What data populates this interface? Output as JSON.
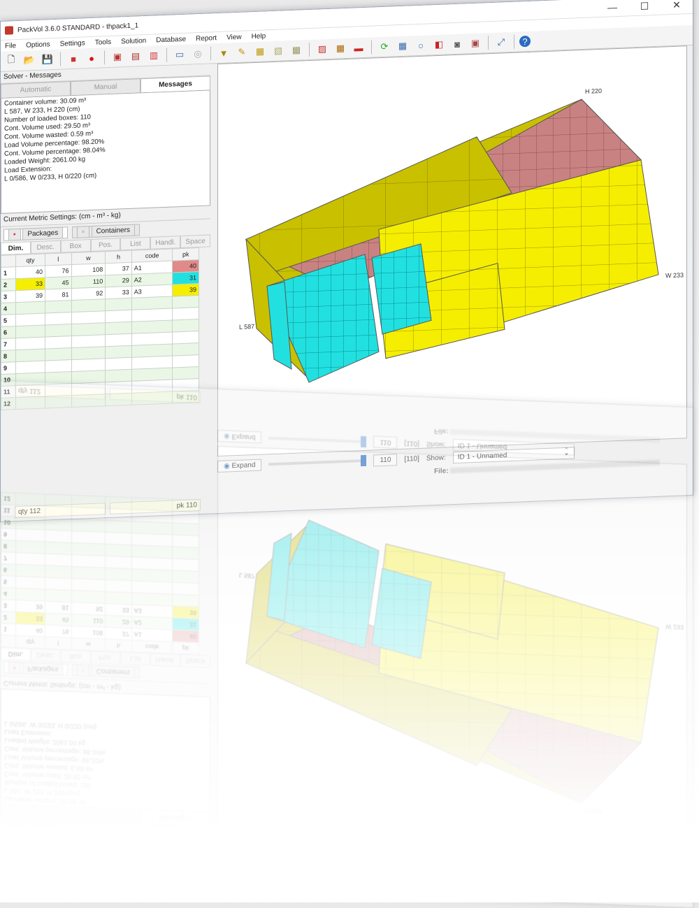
{
  "window": {
    "title": "PackVol 3.6.0 STANDARD - thpack1_1",
    "minimize": "—",
    "maximize": "☐",
    "close": "✕"
  },
  "menu": [
    "File",
    "Options",
    "Settings",
    "Tools",
    "Solution",
    "Database",
    "Report",
    "View",
    "Help"
  ],
  "left": {
    "pane_title": "Solver - Messages",
    "tabs": [
      "Automatic",
      "Manual",
      "Messages"
    ],
    "messages": [
      "Container volume: 30.09 m³",
      "L 587, W 233, H 220 (cm)",
      "Number of loaded boxes: 110",
      "Cont. Volume used: 29.50 m³",
      "Cont. Volume wasted: 0.59 m³",
      "Load Volume percentage: 98.20%",
      "Cont. Volume percentage: 98.04%",
      "Loaded Weight: 2061.00 kg",
      "Load Extension:",
      "L 0/586, W 0/233, H 0/220 (cm)"
    ],
    "settings": "Current Metric Settings: (cm - m³ - kg)",
    "subtabs": [
      "Packages",
      "Containers"
    ],
    "coltabs": [
      "Dim.",
      "Desc.",
      "Box",
      "Pos.",
      "List",
      "Handl.",
      "Space"
    ],
    "columns": [
      "qty",
      "l",
      "w",
      "h",
      "code",
      "pk"
    ],
    "rows": [
      {
        "n": "1",
        "qty": "40",
        "l": "76",
        "w": "108",
        "h": "37",
        "code": "A1",
        "pk": "40",
        "color": "#e08a8a"
      },
      {
        "n": "2",
        "qty": "33",
        "l": "45",
        "w": "110",
        "h": "29",
        "code": "A2",
        "pk": "31",
        "color": "#22e0e0"
      },
      {
        "n": "3",
        "qty": "39",
        "l": "81",
        "w": "92",
        "h": "33",
        "code": "A3",
        "pk": "39",
        "color": "#f5ee00"
      }
    ],
    "empty_rows": [
      "4",
      "5",
      "6",
      "7",
      "8",
      "9",
      "10",
      "11",
      "12"
    ],
    "status_qty": "qty 112",
    "status_pk": "pk 110"
  },
  "view": {
    "label_l": "L 587",
    "label_w": "W 233",
    "label_h": "H 220"
  },
  "bottom": {
    "expand": "Expand",
    "count": "110",
    "count_bracket": "[110]",
    "show_label": "Show:",
    "show_value": "ID 1 - Unnamed",
    "file_label": "File:"
  },
  "colors": {
    "pink": "#c98282",
    "cyan": "#22e0e0",
    "yellow": "#f5ee00",
    "olive": "#c9c000"
  }
}
